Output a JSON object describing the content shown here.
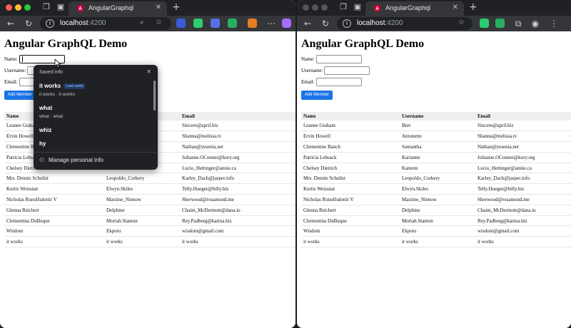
{
  "browser": {
    "tab_title": "AngularGraphql",
    "url_host": "localhost",
    "url_port": ":4200",
    "new_tab": "+",
    "tab_close": "✕"
  },
  "page": {
    "title": "Angular GraphQL Demo",
    "form": {
      "name_label": "Name:",
      "username_label": "Username:",
      "email_label": "Email:",
      "add_button": "Add Member"
    },
    "table": {
      "headers": [
        "Name",
        "Username",
        "Email"
      ],
      "rows": [
        [
          "Leanne Graham",
          "Bret",
          "Sincere@april.biz"
        ],
        [
          "Ervin Howell",
          "Antonette",
          "Shanna@melissa.tv"
        ],
        [
          "Clementine Bauch",
          "Samantha",
          "Nathan@yesenia.net"
        ],
        [
          "Patricia Lebsack",
          "Karianne",
          "Julianne.OConner@kory.org"
        ],
        [
          "Chelsey Dietrich",
          "Kamren",
          "Lucio_Hettinger@annie.ca"
        ],
        [
          "Mrs. Dennis Schulist",
          "Leopoldo_Corkery",
          "Karley_Dach@jasper.info"
        ],
        [
          "Kurtis Weissnat",
          "Elwyn.Skiles",
          "Telly.Hoeger@billy.biz"
        ],
        [
          "Nicholas Runolfsdottir V",
          "Maxime_Nienow",
          "Sherwood@rosamond.me"
        ],
        [
          "Glenna Reichert",
          "Delphine",
          "Chaim_McDermott@dana.io"
        ],
        [
          "Clementina DuBuque",
          "Moriah.Stanton",
          "Rey.Padberg@karina.biz"
        ],
        [
          "Wisdom",
          "Ekpotu",
          "wisdom@gmail.com"
        ],
        [
          "it works",
          "it works",
          "it works"
        ]
      ]
    }
  },
  "autofill": {
    "header": "Saved info",
    "close": "✕",
    "items": [
      {
        "main": "it works",
        "badge": "Last used",
        "sub": "it works · it works"
      },
      {
        "main": "what",
        "sub": "what · what"
      },
      {
        "main": "whiz"
      },
      {
        "main": "hy"
      }
    ],
    "manage": "Manage personal info"
  },
  "colors": {
    "accent_button": "#1a73e8",
    "popup_bg": "#202124",
    "browser_frame": "#202124"
  }
}
